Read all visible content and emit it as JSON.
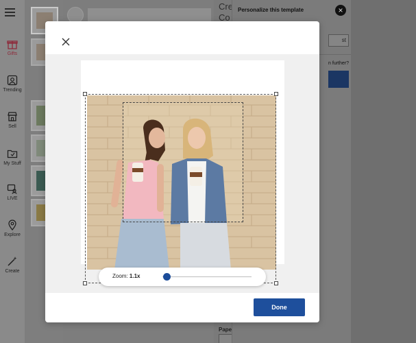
{
  "rail": {
    "items": [
      {
        "label": "Gifts",
        "icon": "gift-icon"
      },
      {
        "label": "Trending",
        "icon": "trending-icon"
      },
      {
        "label": "Sell",
        "icon": "store-icon"
      },
      {
        "label": "My Stuff",
        "icon": "folder-icon"
      },
      {
        "label": "LIVE",
        "icon": "live-icon"
      },
      {
        "label": "Explore",
        "icon": "map-pin-icon"
      },
      {
        "label": "Create",
        "icon": "magic-wand-icon"
      }
    ]
  },
  "middle": {
    "title_fragment": "Cre\nCo",
    "paper_label": "Pape"
  },
  "right_panel": {
    "title": "Personalize this template",
    "button_fragment": "st",
    "question_fragment": "n further?"
  },
  "modal": {
    "zoom": {
      "label": "Zoom:",
      "value": "1.1x",
      "level": 0.05
    },
    "done_label": "Done"
  },
  "colors": {
    "accent": "#1e4f9c",
    "gifts_active": "#8e2a3a",
    "overlay": "#7b7b7b"
  }
}
